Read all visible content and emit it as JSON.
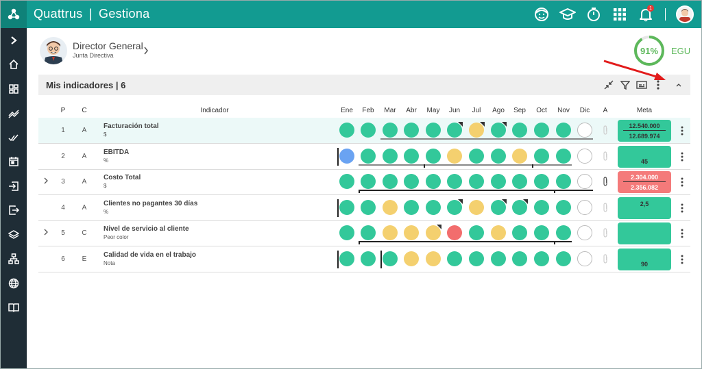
{
  "app": {
    "name": "Quattrus",
    "module": "Gestiona",
    "title_sep": "|"
  },
  "colors": {
    "teal": "#129b91",
    "green": "#33c89a",
    "yellow": "#f4d06f",
    "red": "#f26d6d",
    "blue": "#6aa3f2",
    "pink": "#f47a7a",
    "dark": "#1f2d36"
  },
  "topbar": {
    "icons": [
      "face-icon",
      "graduation-icon",
      "timer-icon",
      "apps-grid-icon",
      "bell-icon",
      "user-avatar"
    ],
    "bell_count": "1"
  },
  "sidebar": {
    "items": [
      "expand-icon",
      "home-icon",
      "dashboard-icon",
      "trend-icon",
      "check-icon",
      "calendar-icon",
      "login-icon",
      "logout-icon",
      "layers-icon",
      "hierarchy-icon",
      "globe-icon",
      "book-icon"
    ]
  },
  "user": {
    "role": "Director General",
    "department": "Junta Directiva"
  },
  "gauge": {
    "value": 0.91,
    "value_label": "91%",
    "label": "EGU"
  },
  "panel": {
    "title": "Mis indicadores | 6"
  },
  "columns": {
    "p": "P",
    "c": "C",
    "indicator": "Indicador",
    "a": "A",
    "meta": "Meta",
    "months": [
      "Ene",
      "Feb",
      "Mar",
      "Abr",
      "May",
      "Jun",
      "Jul",
      "Ago",
      "Sep",
      "Oct",
      "Nov",
      "Dic"
    ]
  },
  "rows": [
    {
      "p": "1",
      "c": "A",
      "name": "Facturación total",
      "unit": "$",
      "expandable": false,
      "months": [
        "green",
        "green",
        "green",
        "green",
        "green",
        "green",
        "yellow",
        "green",
        "green",
        "green",
        "green",
        "empty"
      ],
      "flags": [
        5,
        6,
        7
      ],
      "bars": [],
      "trend_line": [
        2,
        11
      ],
      "trend_color": "#888",
      "meta_color": "green",
      "meta_top": "12.540.000",
      "meta_bottom": "12.689.974",
      "attachment": false
    },
    {
      "p": "2",
      "c": "A",
      "name": "EBITDA",
      "unit": "%",
      "expandable": false,
      "months": [
        "blue",
        "green",
        "green",
        "green",
        "green",
        "yellow",
        "green",
        "green",
        "yellow",
        "green",
        "green",
        "empty"
      ],
      "flags": [],
      "bars": [
        0
      ],
      "trend_line": [
        1,
        10
      ],
      "trend_color": "#888",
      "trend_bracket": [
        4,
        9
      ],
      "meta_color": "green",
      "meta_top": "",
      "meta_bottom": "45",
      "attachment": false
    },
    {
      "p": "3",
      "c": "A",
      "name": "Costo Total",
      "unit": "$",
      "expandable": true,
      "months": [
        "green",
        "green",
        "green",
        "green",
        "green",
        "green",
        "green",
        "green",
        "green",
        "green",
        "green",
        "empty"
      ],
      "flags": [],
      "bars": [],
      "trend_line": [
        1,
        11
      ],
      "trend_color": "#222",
      "trend_bracket": [
        1,
        10
      ],
      "meta_color": "pink",
      "meta_top": "2.304.000",
      "meta_bottom": "2.356.082",
      "attachment": true
    },
    {
      "p": "4",
      "c": "A",
      "name": "Clientes no pagantes 30 días",
      "unit": "%",
      "expandable": false,
      "months": [
        "green",
        "green",
        "yellow",
        "green",
        "green",
        "green",
        "yellow",
        "green",
        "green",
        "green",
        "green",
        "empty"
      ],
      "flags": [
        5,
        7,
        8
      ],
      "bars": [
        0
      ],
      "trend_line": [],
      "trend_color": "#888",
      "meta_color": "green",
      "meta_top": "2,5",
      "meta_bottom": "",
      "attachment": false
    },
    {
      "p": "5",
      "c": "C",
      "name": "Nivel de servicio al cliente",
      "unit": "Peor color",
      "expandable": true,
      "months": [
        "green",
        "green",
        "yellow",
        "yellow",
        "yellow",
        "red",
        "green",
        "yellow",
        "green",
        "green",
        "green",
        "empty"
      ],
      "flags": [
        4
      ],
      "bars": [],
      "trend_line": [
        1,
        10
      ],
      "trend_color": "#222",
      "trend_bracket": [
        1,
        10
      ],
      "meta_color": "green",
      "meta_top": "",
      "meta_bottom": "",
      "attachment": false
    },
    {
      "p": "6",
      "c": "E",
      "name": "Calidad de vida en el trabajo",
      "unit": "Nota",
      "expandable": false,
      "months": [
        "green",
        "green",
        "green",
        "yellow",
        "yellow",
        "green",
        "green",
        "green",
        "green",
        "green",
        "green",
        "empty"
      ],
      "flags": [],
      "bars": [
        0,
        2
      ],
      "trend_line": [],
      "trend_color": "#888",
      "meta_color": "green",
      "meta_top": "",
      "meta_bottom": "90",
      "attachment": false
    }
  ]
}
